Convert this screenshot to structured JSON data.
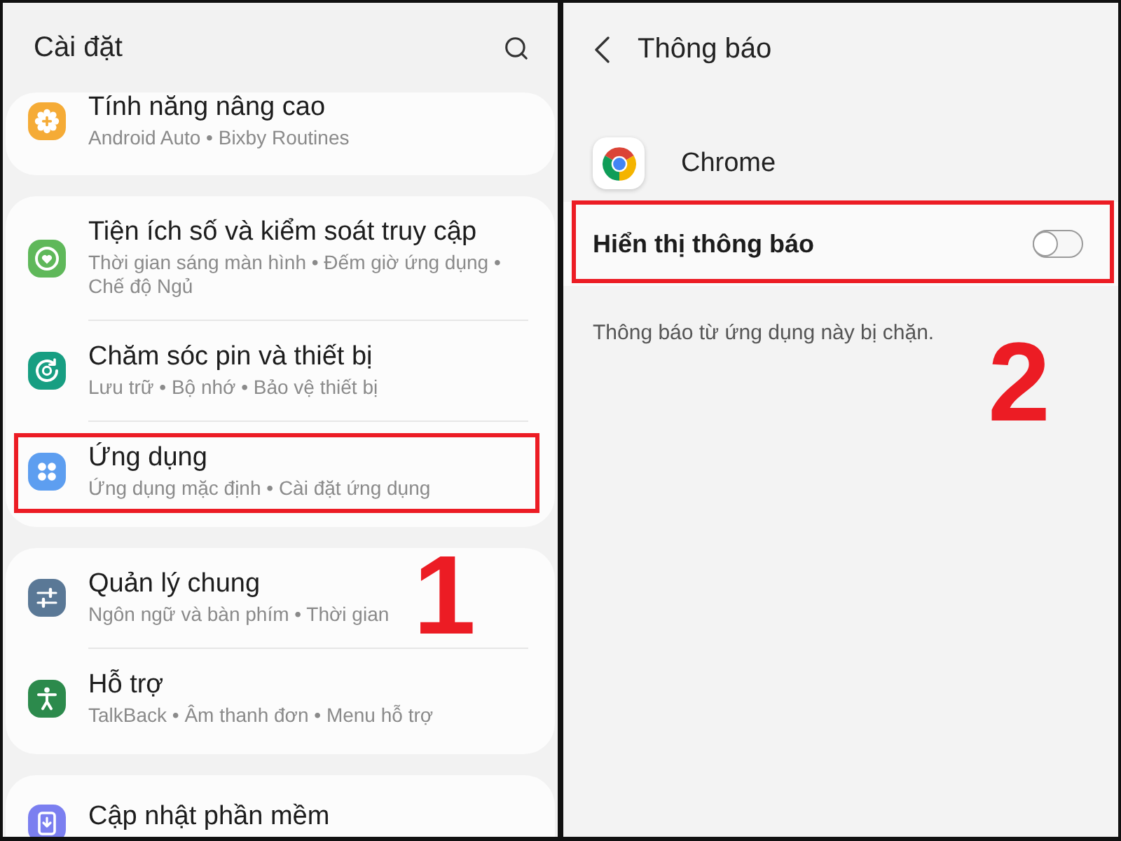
{
  "settings_screen": {
    "title": "Cài đặt",
    "groups": [
      {
        "items": [
          {
            "kind": "advanced",
            "color": "#f5ab36",
            "title": "Tính năng nâng cao",
            "subtitle": "Android Auto • Bixby Routines",
            "highlighted": false
          }
        ]
      },
      {
        "items": [
          {
            "kind": "wellbeing",
            "color": "#5fb85a",
            "title": "Tiện ích số và kiểm soát truy cập",
            "subtitle": "Thời gian sáng màn hình • Đếm giờ ứng dụng • Chế độ Ngủ",
            "highlighted": false
          },
          {
            "kind": "care",
            "color": "#179e82",
            "title": "Chăm sóc pin và thiết bị",
            "subtitle": "Lưu trữ • Bộ nhớ • Bảo vệ thiết bị",
            "highlighted": false
          },
          {
            "kind": "apps",
            "color": "#5d9ef0",
            "title": "Ứng dụng",
            "subtitle": "Ứng dụng mặc định • Cài đặt ứng dụng",
            "highlighted": true
          }
        ]
      },
      {
        "items": [
          {
            "kind": "general",
            "color": "#5a7896",
            "title": "Quản lý chung",
            "subtitle": "Ngôn ngữ và bàn phím • Thời gian",
            "highlighted": false
          },
          {
            "kind": "accessibility",
            "color": "#2c8a4c",
            "title": "Hỗ trợ",
            "subtitle": "TalkBack • Âm thanh đơn • Menu hỗ trợ",
            "highlighted": false
          }
        ]
      },
      {
        "items": [
          {
            "kind": "update",
            "color": "#7b7ff0",
            "title": "Cập nhật phần mềm",
            "highlighted": false
          }
        ]
      }
    ],
    "step_label": "1"
  },
  "notification_screen": {
    "title": "Thông báo",
    "app_name": "Chrome",
    "toggle": {
      "label": "Hiển thị thông báo",
      "on": false,
      "highlighted": true
    },
    "note": "Thông báo từ ứng dụng này bị chặn.",
    "step_label": "2"
  }
}
